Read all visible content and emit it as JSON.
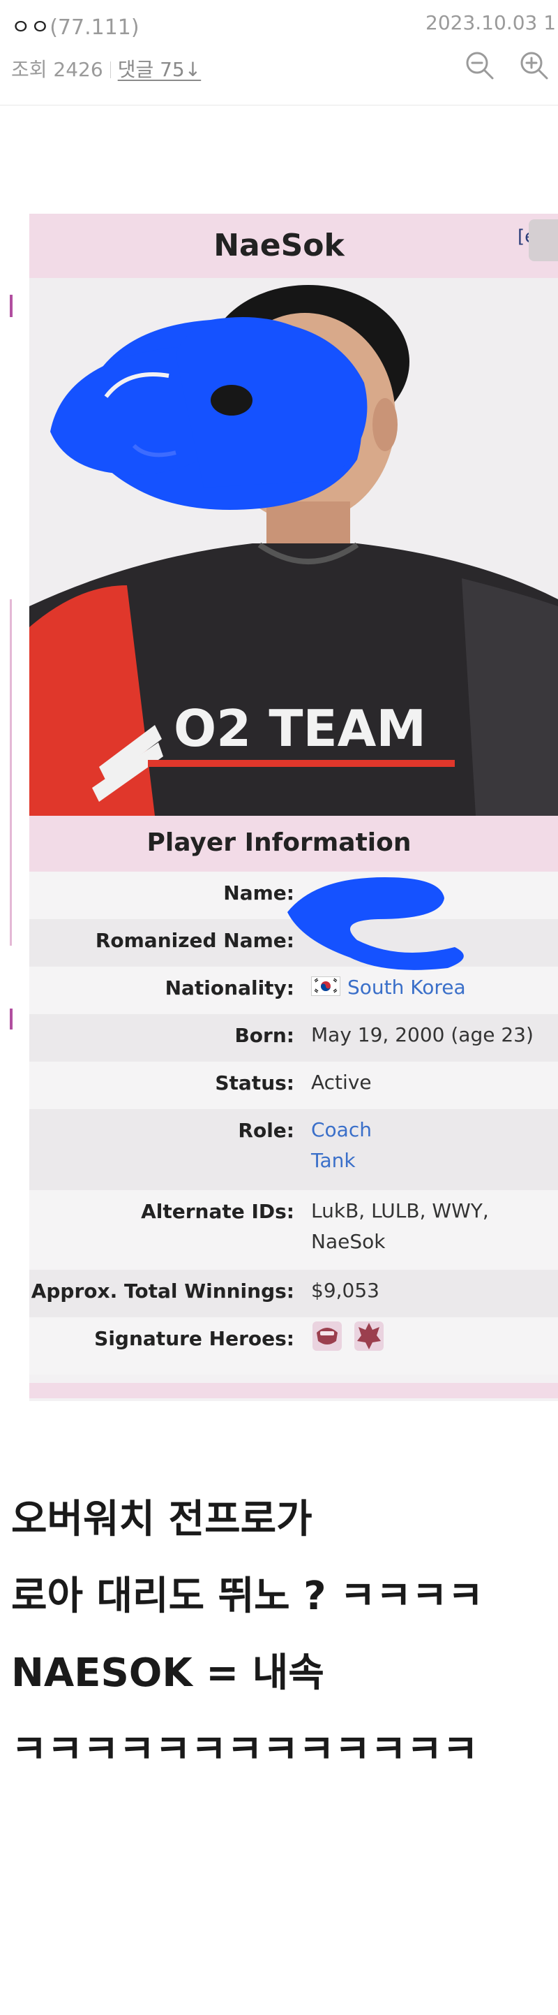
{
  "header": {
    "author_name": "ㅇㅇ",
    "author_ip": "(77.111)",
    "date": "2023.10.03 1",
    "views_label": "조회 2426",
    "comments_label": "댓글 75↓"
  },
  "wiki": {
    "title": "NaeSok",
    "edit_link": "[e]",
    "section_title": "Player Information",
    "rows": [
      {
        "label": "Name:",
        "value": ""
      },
      {
        "label": "Romanized Name:",
        "value": ""
      },
      {
        "label": "Nationality:",
        "value": "South Korea"
      },
      {
        "label": "Born:",
        "value": "May 19, 2000 (age 23)"
      },
      {
        "label": "Status:",
        "value": "Active"
      },
      {
        "label": "Role:",
        "value_lines": [
          "Coach",
          "Tank"
        ]
      },
      {
        "label": "Alternate IDs:",
        "value_lines": [
          "LukB, LULB, WWY,",
          "NaeSok"
        ]
      },
      {
        "label": "Approx. Total Winnings:",
        "value": "$9,053"
      },
      {
        "label": "Signature Heroes:",
        "value": ""
      }
    ],
    "shirt_text": "O2 TEAM"
  },
  "post": {
    "lines": [
      "오버워치 전프로가",
      "로아 대리도 뛰노 ? ㅋㅋㅋㅋ",
      "NAESOK = 내속",
      "ㅋㅋㅋㅋㅋㅋㅋㅋㅋㅋㅋㅋㅋ"
    ]
  },
  "colors": {
    "accent_pink": "#f2dbe7",
    "link_blue": "#3a6fc9",
    "scribble_blue": "#1552ff",
    "shirt_red": "#e0372b"
  },
  "icons": {
    "zoom_out": "zoom-out-icon",
    "zoom_in": "zoom-in-icon",
    "flag": "south-korea-flag-icon",
    "heroes": [
      "winston-hero-icon",
      "doomfist-hero-icon"
    ]
  }
}
